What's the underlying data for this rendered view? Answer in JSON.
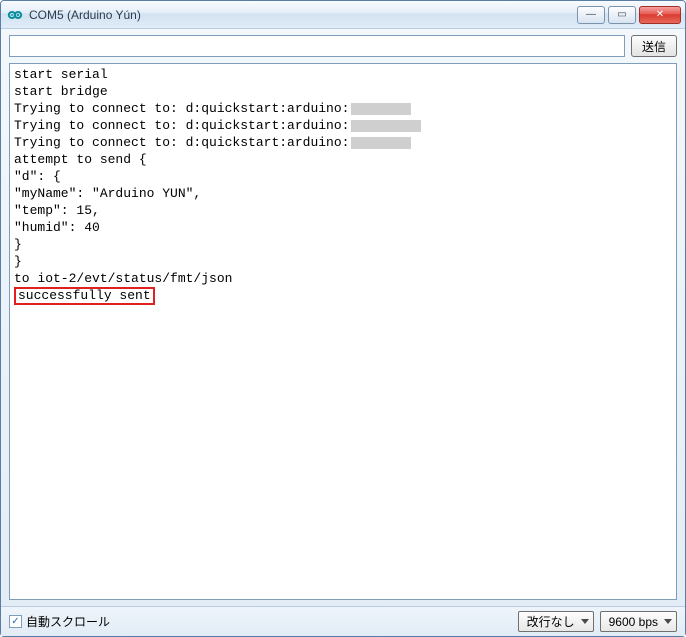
{
  "window": {
    "title": "COM5 (Arduino Yún)"
  },
  "toolbar": {
    "send_label": "送信"
  },
  "input": {
    "value": ""
  },
  "monitor": {
    "lines": [
      "start serial",
      "start bridge",
      "Trying to connect to: d:quickstart:arduino:",
      "Trying to connect to: d:quickstart:arduino:",
      "Trying to connect to: d:quickstart:arduino:",
      "attempt to send {",
      "\"d\": {",
      "\"myName\": \"Arduino YUN\",",
      "\"temp\": 15,",
      "\"humid\": 40",
      "}",
      "}",
      "to iot-2/evt/status/fmt/json",
      "successfully sent"
    ],
    "redacted_indices": [
      2,
      3,
      4
    ],
    "highlight_index": 13
  },
  "footer": {
    "autoscroll_label": "自動スクロール",
    "autoscroll_checked": true,
    "line_ending_selected": "改行なし",
    "baud_selected": "9600 bps"
  },
  "icons": {
    "minimize": "—",
    "maximize": "▭",
    "close": "✕",
    "check": "✓"
  }
}
